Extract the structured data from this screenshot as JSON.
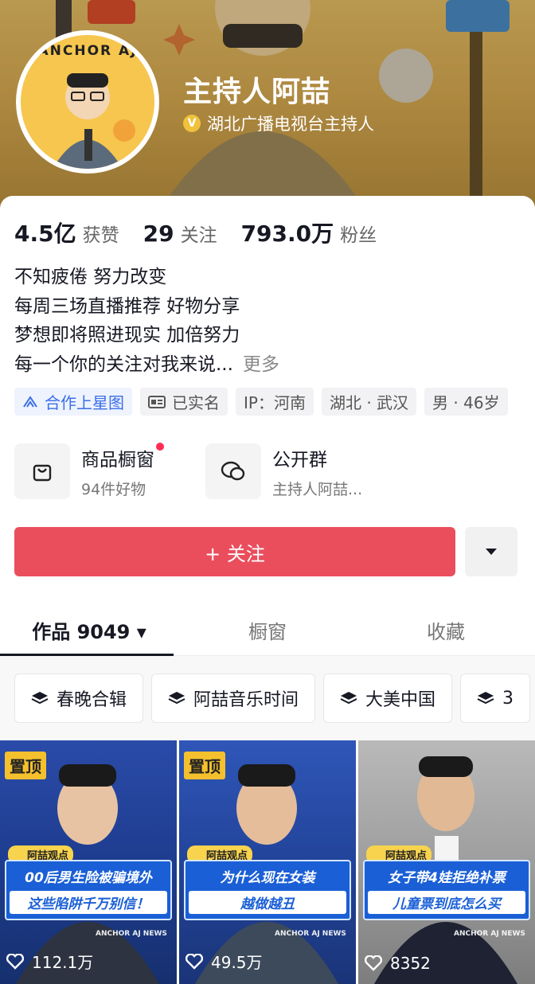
{
  "profile": {
    "name": "主持人阿喆",
    "verify_icon": "V",
    "verify_text": "湖北广播电视台主持人",
    "avatar_text": "ANCHOR AJ"
  },
  "stats": [
    {
      "num": "4.5亿",
      "label": "获赞"
    },
    {
      "num": "29",
      "label": "关注"
    },
    {
      "num": "793.0万",
      "label": "粉丝"
    }
  ],
  "bio": {
    "lines": [
      "不知疲倦 努力改变",
      "每周三场直播推荐 好物分享",
      "梦想即将照进现实 加倍努力",
      "每一个你的关注对我来说..."
    ],
    "more": "更多"
  },
  "tags": [
    {
      "label": "合作上星图",
      "icon": "star-chart-icon"
    },
    {
      "label": "已实名",
      "icon": "id-card-icon"
    },
    {
      "label": "IP：河南"
    },
    {
      "label": "湖北 · 武汉"
    },
    {
      "label": "男 · 46岁"
    }
  ],
  "services": [
    {
      "title": "商品橱窗",
      "sub": "94件好物",
      "icon": "shopping-bag-icon"
    },
    {
      "title": "公开群",
      "sub": "主持人阿喆...",
      "icon": "group-chat-icon"
    }
  ],
  "actions": {
    "follow": "+ 关注",
    "dropdown_icon": "caret-down-icon"
  },
  "tabs": [
    {
      "label": "作品 9049 ▾",
      "active": true
    },
    {
      "label": "橱窗",
      "active": false
    },
    {
      "label": "收藏",
      "active": false
    }
  ],
  "collections": [
    "春晚合辑",
    "阿喆音乐时间",
    "大美中国",
    "3"
  ],
  "videos": [
    {
      "pinned": "置顶",
      "tag": "阿喆观点",
      "line1": "00后男生险被骗境外",
      "line2": "这些陷阱千万别信！",
      "news": "ANCHOR AJ NEWS",
      "likes": "112.1万"
    },
    {
      "pinned": "置顶",
      "tag": "阿喆观点",
      "line1": "为什么现在女装",
      "line2": "越做越丑",
      "news": "ANCHOR AJ NEWS",
      "likes": "49.5万"
    },
    {
      "pinned": "",
      "tag": "阿喆观点",
      "line1": "女子带4娃拒绝补票",
      "line2": "儿童票到底怎么买",
      "news": "ANCHOR AJ NEWS",
      "likes": "8352"
    }
  ],
  "colors": {
    "follow": "#ea4e5d",
    "pin": "#f5c02d",
    "caption": "#1a5fd6",
    "link": "#3b6ee8"
  }
}
